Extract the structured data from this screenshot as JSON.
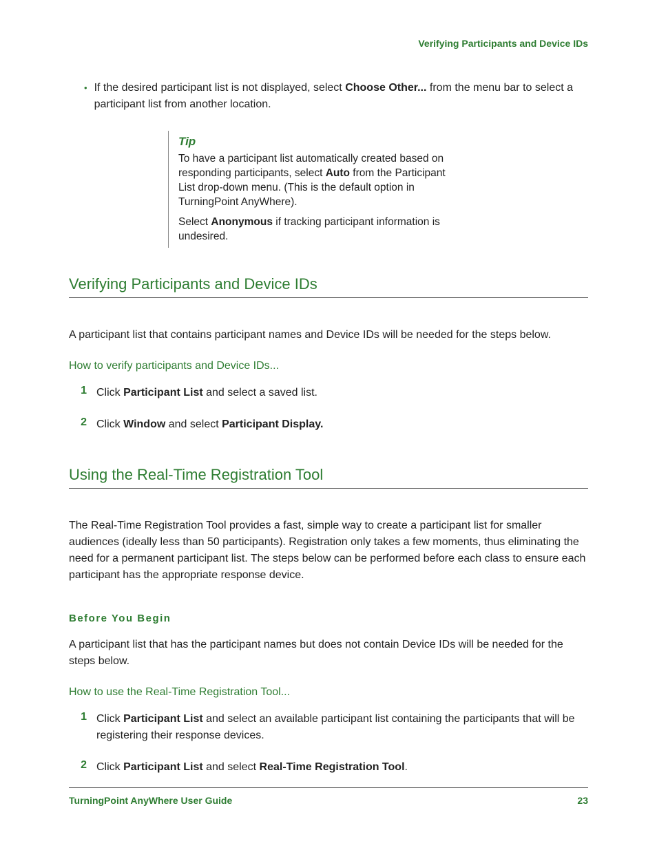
{
  "running_head": "Verifying Participants and Device IDs",
  "bullet": {
    "pre": "If the desired participant list is not displayed, select ",
    "bold": "Choose Other...",
    "post": " from the menu bar to select a participant list from another location."
  },
  "tip": {
    "heading": "Tip",
    "p1_pre": "To have a participant list automatically created based on responding participants, select ",
    "p1_bold": "Auto",
    "p1_post": " from the Participant List drop-down menu. (This is the default option in TurningPoint AnyWhere).",
    "p2_pre": "Select ",
    "p2_bold": "Anonymous",
    "p2_post": " if tracking participant information is undesired."
  },
  "sec1": {
    "heading": "Verifying Participants and Device IDs",
    "intro": "A participant list that contains participant names and Device IDs will be needed for the steps below.",
    "howto": "How to verify participants and Device IDs...",
    "step1_num": "1",
    "step1_pre": "Click ",
    "step1_b1": "Participant List",
    "step1_post": " and select a saved list.",
    "step2_num": "2",
    "step2_pre": "Click ",
    "step2_b1": "Window",
    "step2_mid": " and select ",
    "step2_b2": "Participant Display."
  },
  "sec2": {
    "heading": "Using the Real-Time Registration Tool",
    "intro": "The Real-Time Registration Tool provides a fast, simple way to create a participant list for smaller audiences (ideally less than 50 participants). Registration only takes a few moments, thus eliminating the need for a permanent participant list. The steps below can be performed before each class to ensure each participant has the appropriate response device.",
    "subhead": "Before You Begin",
    "before_para": "A participant list that has the participant names but does not contain Device IDs will be needed for the steps below.",
    "howto": "How to use the Real-Time Registration Tool...",
    "step1_num": "1",
    "step1_pre": "Click ",
    "step1_b1": "Participant List",
    "step1_post": " and select an available participant list containing the participants that will be registering their response devices.",
    "step2_num": "2",
    "step2_pre": "Click ",
    "step2_b1": "Participant List",
    "step2_mid": " and select ",
    "step2_b2": "Real-Time Registration Tool",
    "step2_post": "."
  },
  "footer": {
    "title": "TurningPoint AnyWhere User Guide",
    "page": "23"
  }
}
